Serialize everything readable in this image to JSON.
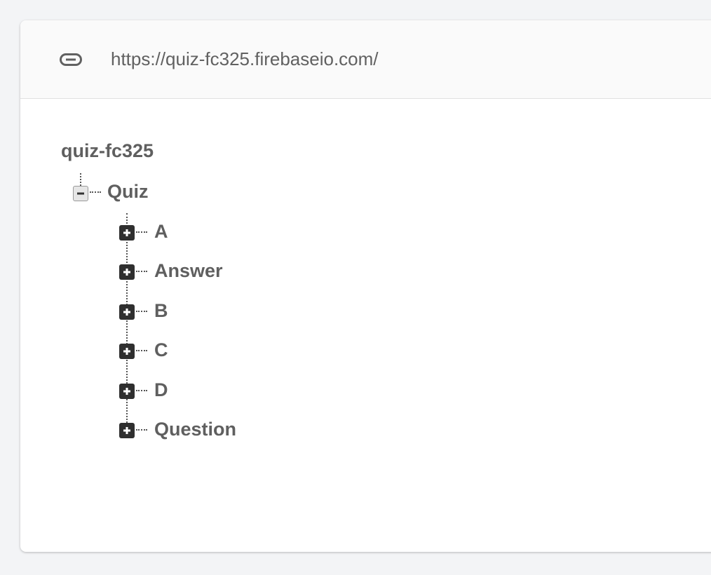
{
  "url_bar": {
    "icon": "link-icon",
    "url": "https://quiz-fc325.firebaseio.com/"
  },
  "tree": {
    "root": "quiz-fc325",
    "nodes": [
      {
        "label": "Quiz",
        "expanded": true,
        "children": [
          {
            "label": "A",
            "expanded": false
          },
          {
            "label": "Answer",
            "expanded": false
          },
          {
            "label": "B",
            "expanded": false
          },
          {
            "label": "C",
            "expanded": false
          },
          {
            "label": "D",
            "expanded": false
          },
          {
            "label": "Question",
            "expanded": false
          }
        ]
      }
    ]
  },
  "colors": {
    "page_background": "#f3f4f6",
    "text": "#5f5f5f",
    "expand_toggle": "#2f2f2f",
    "collapse_toggle": "#e6e6e6"
  }
}
